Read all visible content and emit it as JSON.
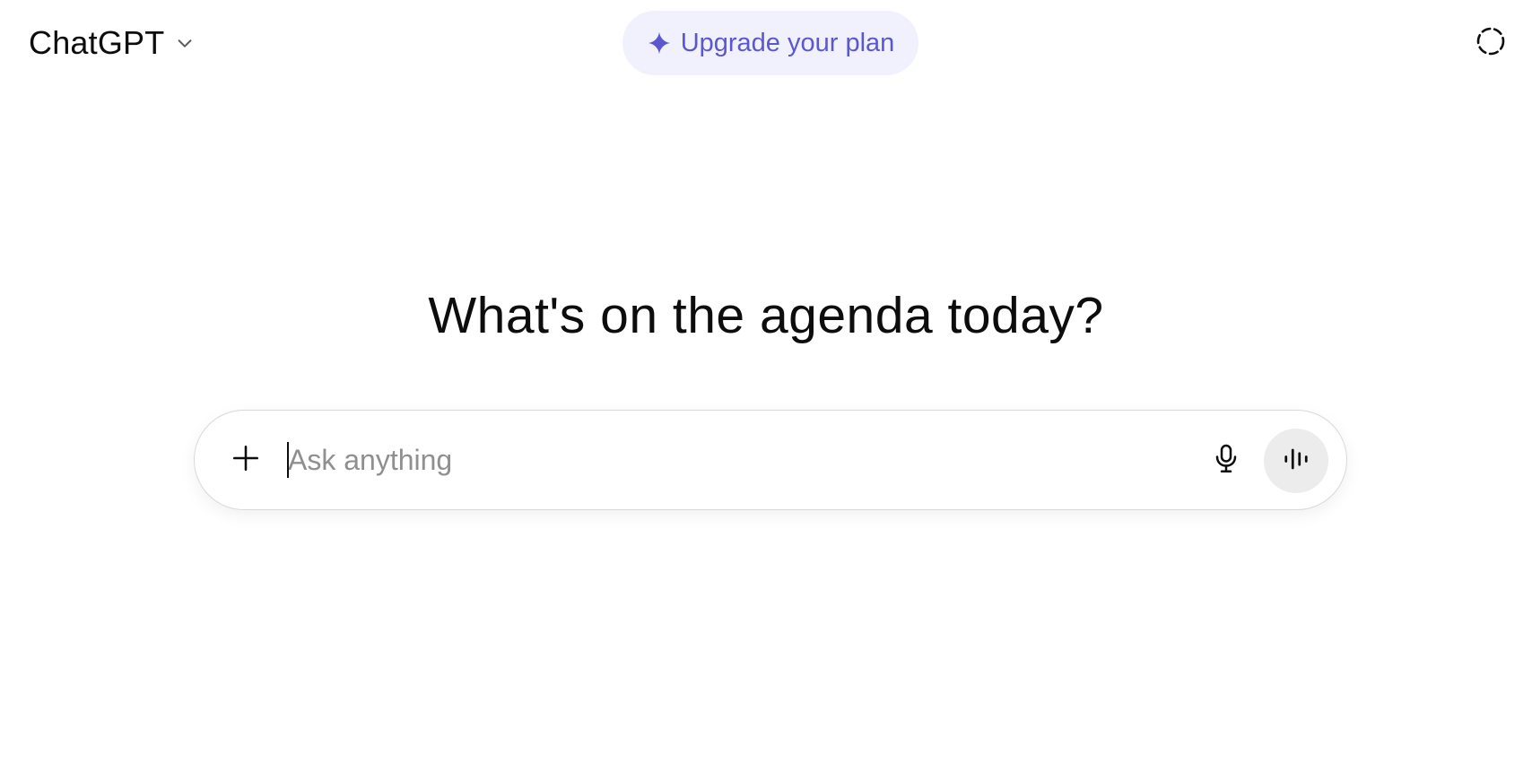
{
  "header": {
    "model_name": "ChatGPT",
    "model_dropdown_icon": "chevron-down-icon",
    "upgrade_label": "Upgrade your plan",
    "upgrade_icon": "sparkle-icon",
    "temporary_chat_icon": "temporary-chat-icon"
  },
  "main": {
    "headline": "What's on the agenda today?"
  },
  "composer": {
    "placeholder": "Ask anything",
    "value": "",
    "attach_icon": "plus-icon",
    "dictate_icon": "microphone-icon",
    "voice_mode_icon": "voice-waveform-icon"
  },
  "colors": {
    "upgrade_bg": "#f1f0fd",
    "upgrade_text": "#5b57d1",
    "voice_btn_bg": "#ececec",
    "placeholder_text": "#8f8f8f"
  }
}
